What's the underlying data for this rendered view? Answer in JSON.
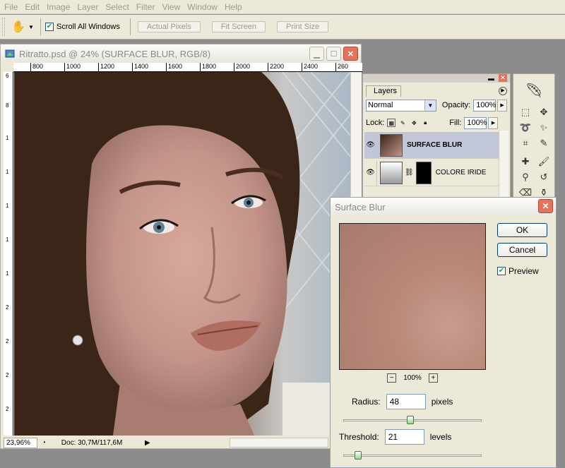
{
  "menu": {
    "items": [
      "File",
      "Edit",
      "Image",
      "Layer",
      "Select",
      "Filter",
      "View",
      "Window",
      "Help"
    ]
  },
  "options_bar": {
    "tool_icon": "hand-icon",
    "scroll_all_windows_label": "Scroll All Windows",
    "scroll_all_windows_checked": true,
    "actual_pixels_label": "Actual Pixels",
    "fit_screen_label": "Fit Screen",
    "print_size_label": "Print Size"
  },
  "document": {
    "title": "Ritratto.psd @ 24% (SURFACE BLUR, RGB/8)",
    "ruler_top_labels": [
      "800",
      "1000",
      "1200",
      "1400",
      "1600",
      "1800",
      "2000",
      "2200",
      "2400",
      "260"
    ],
    "ruler_left_labels": [
      "600",
      "800",
      "1000",
      "1200",
      "1400",
      "1600",
      "1800",
      "2000",
      "2200",
      "2400",
      "260"
    ],
    "zoom_value": "23,96%",
    "doc_info": "Doc: 30,7M/117,6M"
  },
  "layers_panel": {
    "tab_label": "Layers",
    "blend_mode": "Normal",
    "opacity_label": "Opacity:",
    "opacity_value": "100%",
    "lock_label": "Lock:",
    "fill_label": "Fill:",
    "fill_value": "100%",
    "layers": [
      {
        "name": "SURFACE BLUR",
        "visible": true,
        "active": true
      },
      {
        "name": "COLORE IRIDE",
        "visible": true,
        "active": false
      }
    ]
  },
  "dialog": {
    "title": "Surface Blur",
    "ok_label": "OK",
    "cancel_label": "Cancel",
    "preview_label": "Preview",
    "preview_checked": true,
    "zoom_level": "100%",
    "radius_label": "Radius:",
    "radius_value": "48",
    "radius_unit": "pixels",
    "radius_slider_fraction": 0.48,
    "threshold_label": "Threshold:",
    "threshold_value": "21",
    "threshold_unit": "levels",
    "threshold_slider_fraction": 0.08
  },
  "colors": {
    "dialog_close": "#e2735c",
    "slider_thumb": "#9bd19b",
    "active_layer": "#c1c7d8"
  }
}
